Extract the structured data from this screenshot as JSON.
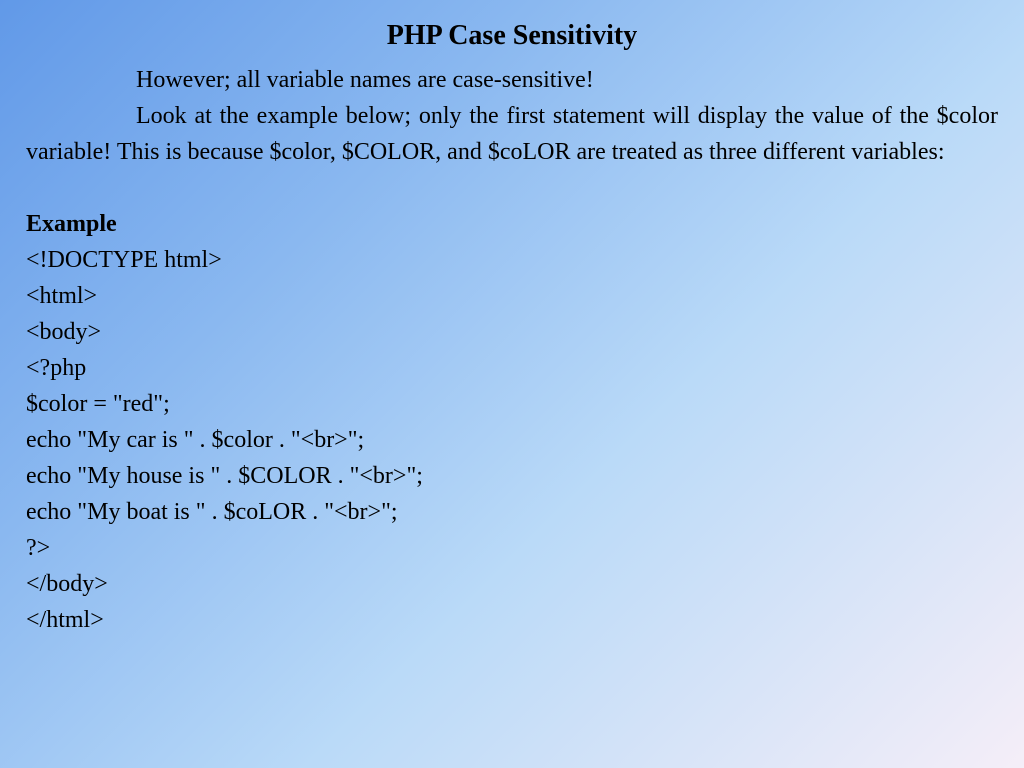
{
  "title": "PHP Case Sensitivity",
  "para1": "However; all variable names are case-sensitive!",
  "para2": "Look at the example below; only the first statement will display the value of the $color variable! This is because $color, $COLOR, and $coLOR are treated as three different variables:",
  "example_label": "Example",
  "code": {
    "l1": "<!DOCTYPE html>",
    "l2": "<html>",
    "l3": "<body>",
    "l4": "<?php",
    "l5": "$color = \"red\";",
    "l6": "echo \"My car is \" . $color . \"<br>\";",
    "l7": "echo \"My house is \" . $COLOR . \"<br>\";",
    "l8": "echo \"My boat is \" . $coLOR . \"<br>\";",
    "l9": "?>",
    "l10": "</body>",
    "l11": "</html>"
  }
}
